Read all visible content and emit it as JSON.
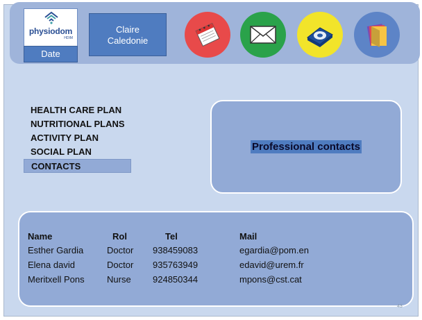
{
  "brand": {
    "logo_text": "physiodom",
    "logo_sub": "HDIM",
    "date_label": "Date"
  },
  "user": {
    "first_name": "Claire",
    "last_name": "Caledonie"
  },
  "toolbar": {
    "icons": [
      {
        "name": "calendar-icon",
        "color": "#e84a4a"
      },
      {
        "name": "mail-icon",
        "color": "#2aa24a"
      },
      {
        "name": "scale-icon",
        "color": "#f2e42a"
      },
      {
        "name": "folders-icon",
        "color": "#5d84c7"
      }
    ]
  },
  "menu": {
    "items": [
      {
        "label": "HEALTH CARE PLAN"
      },
      {
        "label": "NUTRITIONAL PLANS"
      },
      {
        "label": "ACTIVITY PLAN"
      },
      {
        "label": "SOCIAL PLAN"
      },
      {
        "label": "CONTACTS",
        "active": true
      }
    ]
  },
  "panel": {
    "title": "Professional contacts"
  },
  "contacts": {
    "headers": {
      "name": "Name",
      "rol": "Rol",
      "tel": "Tel",
      "mail": "Mail"
    },
    "rows": [
      {
        "name": "Esther Gardia",
        "rol": "Doctor",
        "tel": "938459083",
        "mail": "egardia@pom.en"
      },
      {
        "name": "Elena david",
        "rol": "Doctor",
        "tel": "935763949",
        "mail": "edavid@urem.fr"
      },
      {
        "name": "Meritxell Pons",
        "rol": "Nurse",
        "tel": "924850344",
        "mail": "mpons@cst.cat"
      }
    ]
  },
  "page_number": "43",
  "colors": {
    "accent": "#4f7cc0",
    "background": "#c9d8ee",
    "card": "#92aad6"
  }
}
